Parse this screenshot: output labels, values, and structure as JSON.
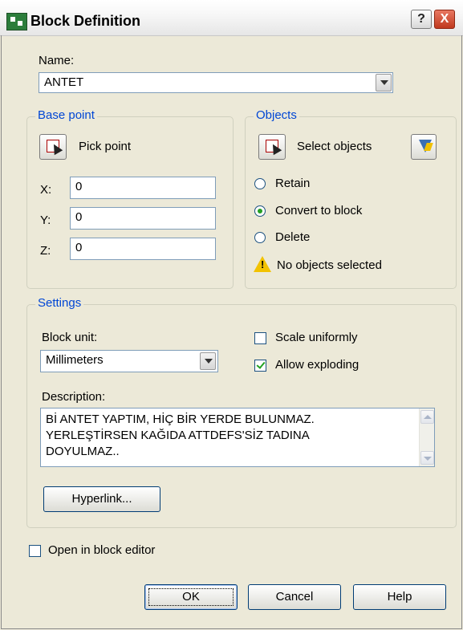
{
  "window": {
    "title": "Block Definition",
    "help_label": "?",
    "close_label": "X"
  },
  "name": {
    "label": "Name:",
    "value": "ANTET"
  },
  "base_point": {
    "legend": "Base point",
    "pick_label": "Pick point",
    "x_label": "X:",
    "x_value": "0",
    "y_label": "Y:",
    "y_value": "0",
    "z_label": "Z:",
    "z_value": "0"
  },
  "objects": {
    "legend": "Objects",
    "select_label": "Select objects",
    "options": [
      "Retain",
      "Convert to block",
      "Delete"
    ],
    "selected_option": "Convert to block",
    "status": "No objects selected"
  },
  "settings": {
    "legend": "Settings",
    "unit_label": "Block unit:",
    "unit_value": "Millimeters",
    "scale_uniformly_label": "Scale uniformly",
    "scale_uniformly_checked": false,
    "allow_exploding_label": "Allow exploding",
    "allow_exploding_checked": true,
    "description_label": "Description:",
    "description_lines": [
      "Bİ ANTET YAPTIM, HİÇ BİR YERDE BULUNMAZ.",
      "YERLEŞTİRSEN KAĞIDA ATTDEFS'SİZ TADINA",
      "DOYULMAZ.."
    ],
    "hyperlink_label": "Hyperlink..."
  },
  "open_in_editor": {
    "label": "Open in block editor",
    "checked": false
  },
  "footer": {
    "ok_label": "OK",
    "cancel_label": "Cancel",
    "help_label": "Help"
  },
  "colors": {
    "dialog_bg": "#ece9d8",
    "group_legend": "#0046d5",
    "input_border": "#7f9db9",
    "check_green": "#21a121",
    "warning_yellow": "#f2c200"
  }
}
